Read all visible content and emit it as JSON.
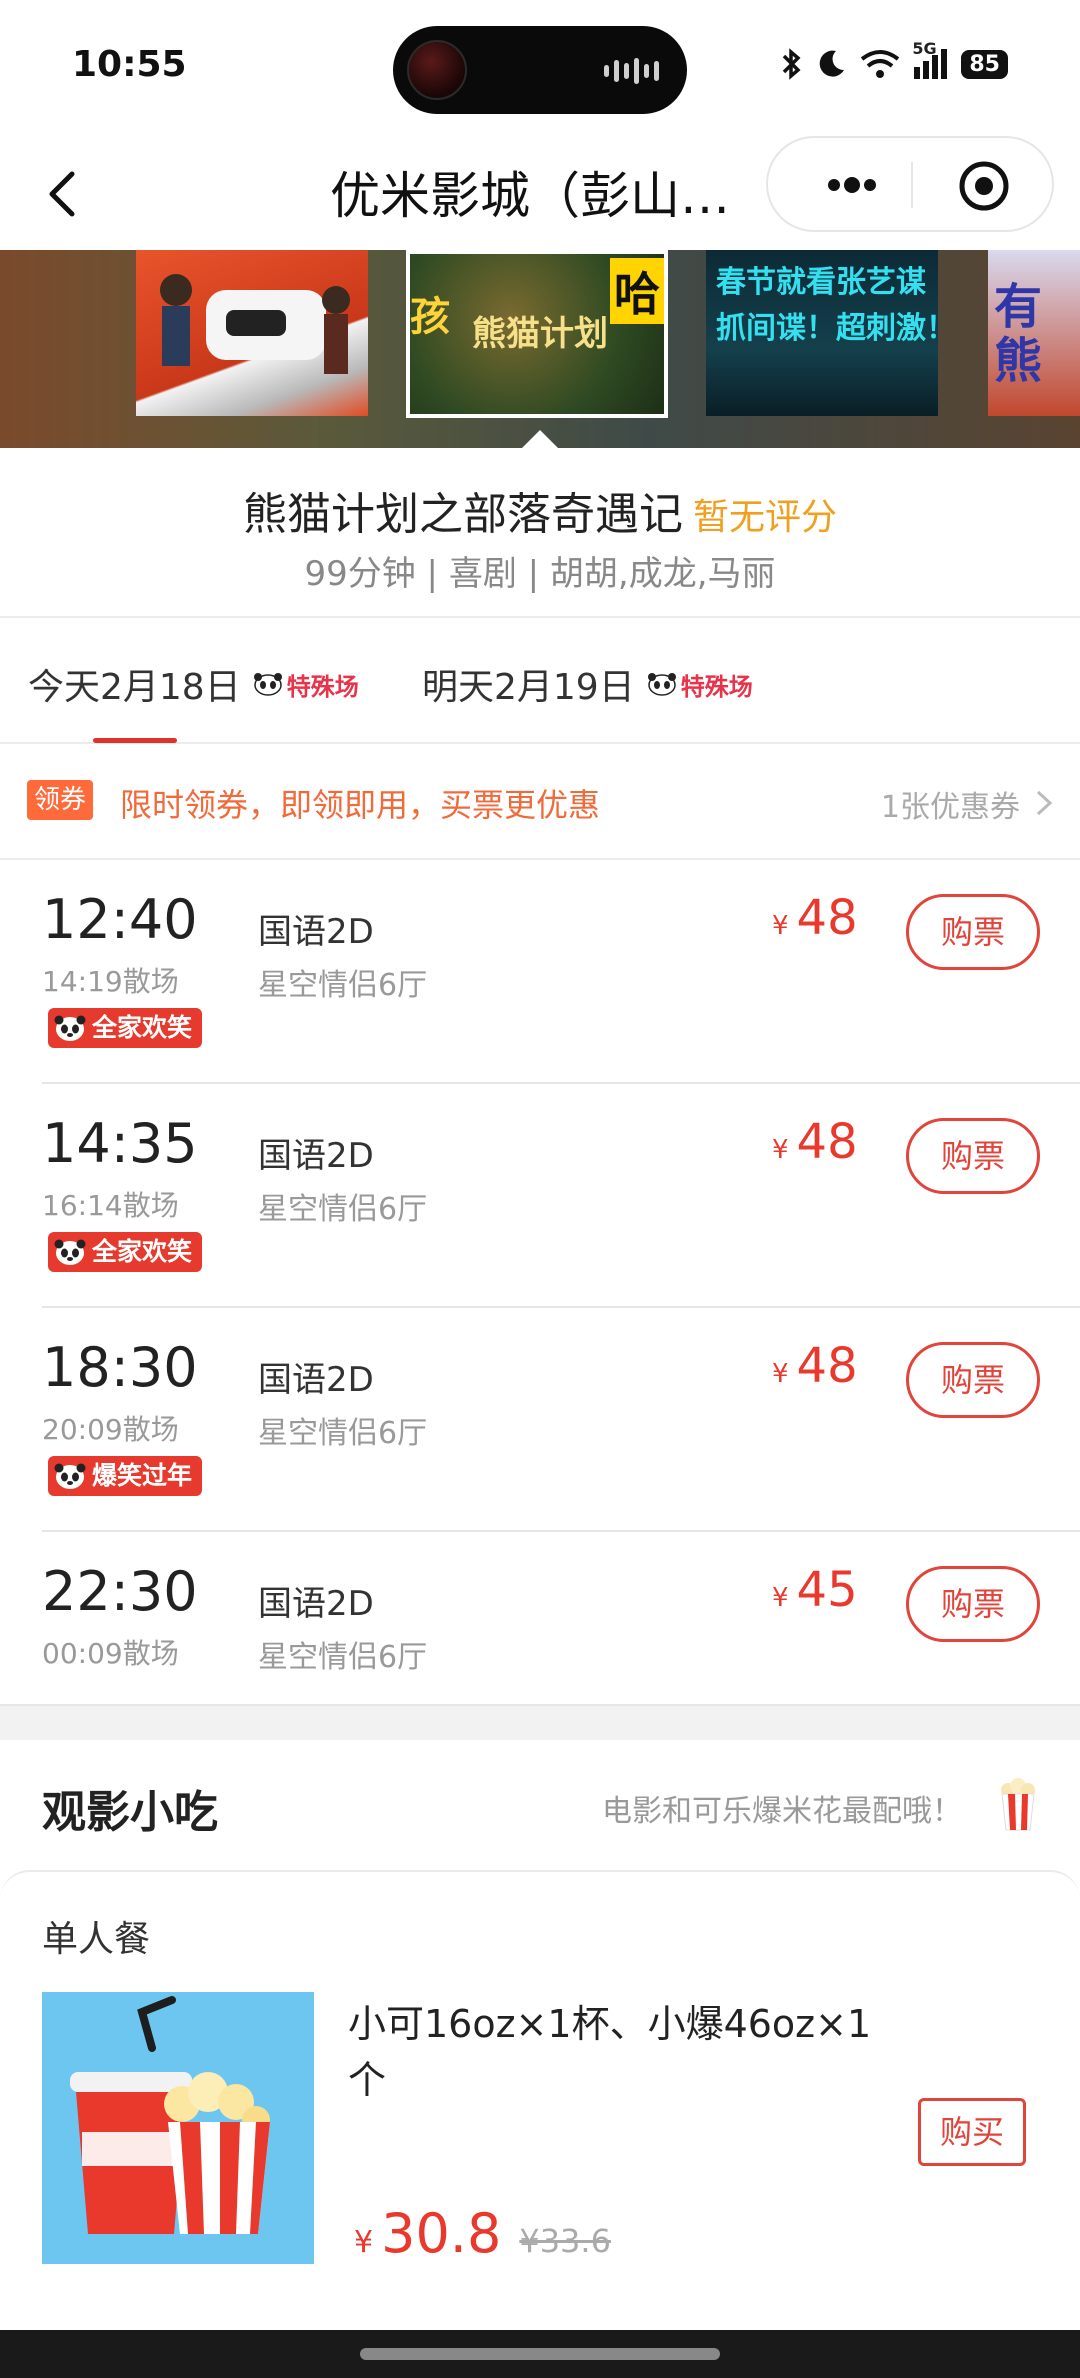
{
  "status_bar": {
    "time": "10:55",
    "network": "5G",
    "battery": "85"
  },
  "nav": {
    "title": "优米影城（彭山…",
    "back_icon": "chevron-left-icon",
    "more_icon": "more-dots-icon",
    "close_icon": "target-close-icon"
  },
  "banner": {
    "posters": [
      {
        "text": ""
      },
      {
        "text_a": "孩",
        "text_b": "熊猫计划",
        "text_c": "哈"
      },
      {
        "text": "春节就看张艺谋\n抓间谍！超刺激！"
      },
      {
        "text": "有\n熊"
      }
    ]
  },
  "movie": {
    "title": "熊猫计划之部落奇遇记",
    "score": "暂无评分",
    "meta": "99分钟 | 喜剧 | 胡胡,成龙,马丽"
  },
  "date_tabs": [
    {
      "label": "今天2月18日",
      "tag": "特殊场",
      "active": true
    },
    {
      "label": "明天2月19日",
      "tag": "特殊场",
      "active": false
    }
  ],
  "coupon": {
    "badge": "领券",
    "text": "限时领券，即领即用，买票更优惠",
    "count": "1张优惠券"
  },
  "currency": "¥",
  "showtimes": [
    {
      "start": "12:40",
      "end": "14:19散场",
      "tag": "全家欢笑",
      "lang": "国语2D",
      "hall": "星空情侣6厅",
      "price": "48",
      "buy": "购票"
    },
    {
      "start": "14:35",
      "end": "16:14散场",
      "tag": "全家欢笑",
      "lang": "国语2D",
      "hall": "星空情侣6厅",
      "price": "48",
      "buy": "购票"
    },
    {
      "start": "18:30",
      "end": "20:09散场",
      "tag": "爆笑过年",
      "lang": "国语2D",
      "hall": "星空情侣6厅",
      "price": "48",
      "buy": "购票"
    },
    {
      "start": "22:30",
      "end": "00:09散场",
      "tag": "",
      "lang": "国语2D",
      "hall": "星空情侣6厅",
      "price": "45",
      "buy": "购票"
    }
  ],
  "snacks": {
    "title": "观影小吃",
    "slogan": "电影和可乐爆米花最配哦！",
    "card": {
      "category": "单人餐",
      "desc": "小可16oz×1杯、小爆46oz×1个",
      "price": "30.8",
      "original_price": "¥33.6",
      "buy": "购买"
    }
  },
  "colors": {
    "accent_red": "#e0443a",
    "score_yellow": "#f0a020",
    "coupon_orange": "#f06a3a"
  }
}
